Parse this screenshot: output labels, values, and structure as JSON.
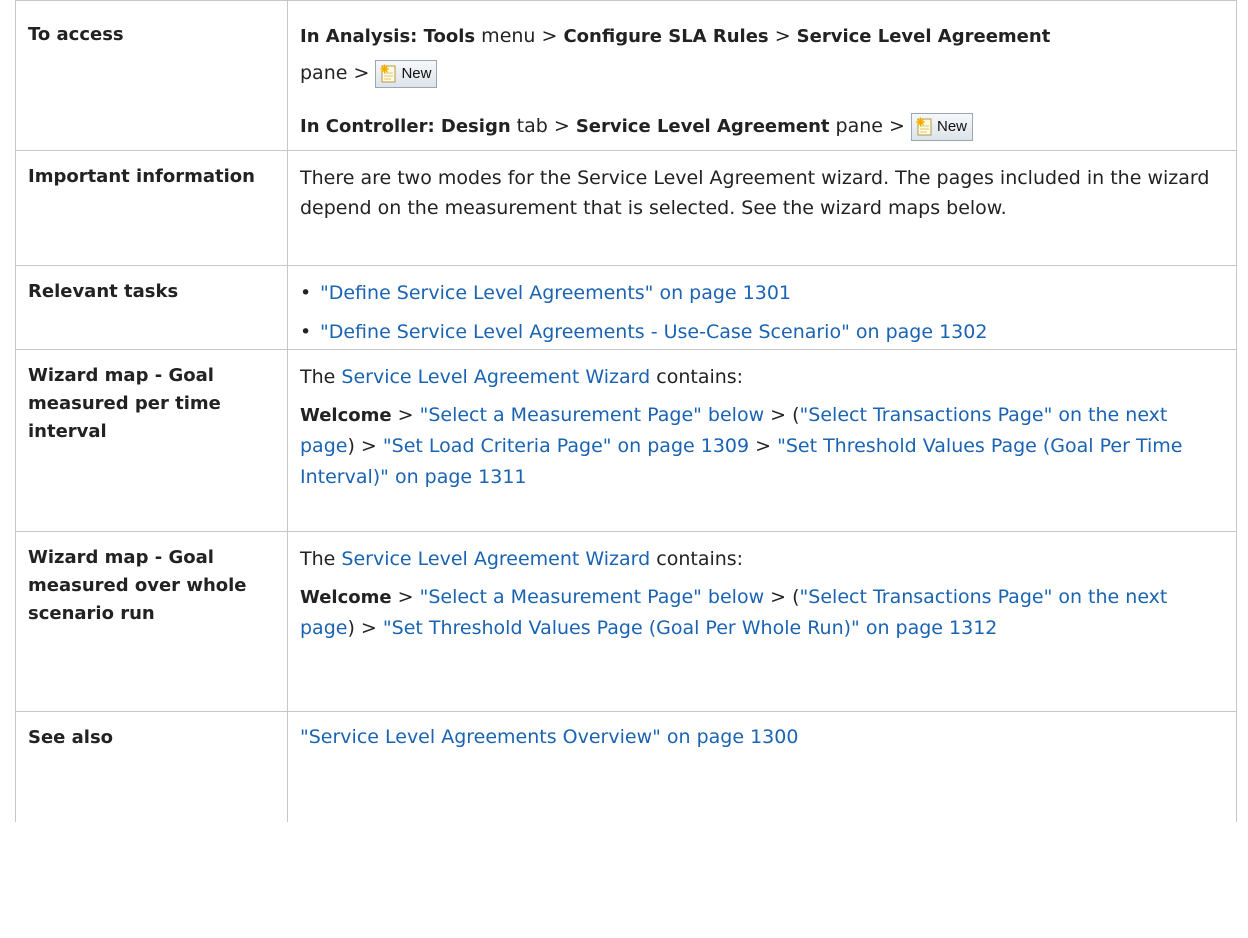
{
  "rows": {
    "access": {
      "label": "To access",
      "line1": {
        "p1": "In Analysis: Tools",
        "p2": " menu > ",
        "p3": "Configure SLA Rules",
        "p4": " > ",
        "p5": "Service Level Agreement",
        "p6": "pane > "
      },
      "line2": {
        "p1": "In Controller: Design",
        "p2": " tab > ",
        "p3": "Service Level Agreement",
        "p4": " pane > "
      },
      "new_button_label": "New",
      "new_icon": "new-document-sparkle-icon"
    },
    "important": {
      "label": "Important information",
      "text": "There are two modes for the Service Level Agreement wizard. The pages included in the wizard depend on the measurement that is selected. See the wizard maps below."
    },
    "tasks": {
      "label": "Relevant tasks",
      "items": [
        "\"Define Service Level Agreements\" on page 1301",
        "\"Define Service Level Agreements - Use-Case Scenario\" on page 1302"
      ]
    },
    "map_interval": {
      "label": "Wizard map - Goal measured per time interval",
      "intro_pre": "The ",
      "intro_link": "Service Level Agreement Wizard",
      "intro_post": " contains:",
      "welcome": "Welcome",
      "sep": " > ",
      "link1": "\"Select a Measurement Page\" below",
      "paren_open": " > (",
      "link2": "\"Select Transactions Page\" on the next page",
      "paren_close": ") > ",
      "link3": "\"Set Load Criteria Page\" on page 1309",
      "link4": "\"Set Threshold Values Page (Goal Per Time Interval)\" on page 1311"
    },
    "map_whole": {
      "label": "Wizard map - Goal measured over whole scenario run",
      "intro_pre": "The ",
      "intro_link": "Service Level Agreement Wizard",
      "intro_post": " contains:",
      "welcome": "Welcome",
      "sep": " > ",
      "link1": "\"Select a Measurement Page\" below",
      "paren_open": " > (",
      "link2": "\"Select Transactions Page\" on the next page",
      "paren_close": ") > ",
      "link3": "\"Set Threshold Values Page (Goal Per Whole Run)\" on page 1312"
    },
    "see_also": {
      "label": "See also",
      "link": "\"Service Level Agreements Overview\" on page 1300"
    }
  },
  "colors": {
    "link": "#1a63b3",
    "border": "#c6c6c6",
    "text": "#222222"
  }
}
